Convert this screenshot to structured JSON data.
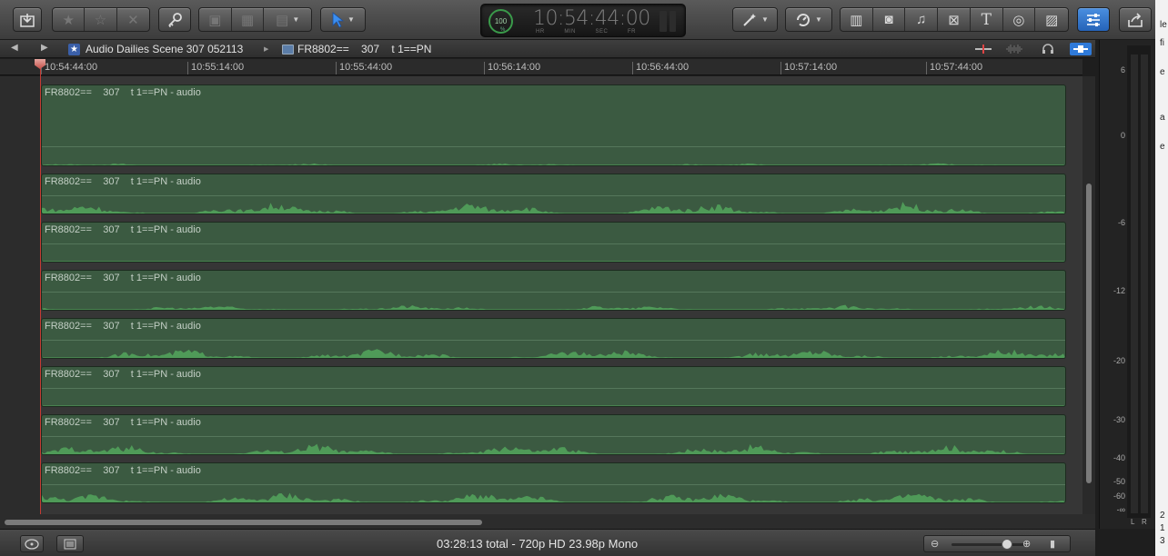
{
  "toolbar": {
    "timecode": "10:54:44:00",
    "timecode_labels": [
      "HR",
      "MIN",
      "SEC",
      "FR"
    ],
    "playback_percent": "100",
    "playback_percent_unit": "%"
  },
  "pathbar": {
    "project": "Audio Dailies Scene 307 052113",
    "clip": "FR8802==    307    t 1==PN"
  },
  "ruler": {
    "ticks": [
      "10:54:44:00",
      "10:55:14:00",
      "10:55:44:00",
      "10:56:14:00",
      "10:56:44:00",
      "10:57:14:00",
      "10:57:44:00"
    ]
  },
  "clips": [
    {
      "label": "FR8802==    307    t 1==PN - audio",
      "waveform_level": 0.1
    },
    {
      "label": "FR8802==    307    t 1==PN - audio",
      "waveform_level": 0.6
    },
    {
      "label": "FR8802==    307    t 1==PN - audio",
      "waveform_level": 0.0
    },
    {
      "label": "FR8802==    307    t 1==PN - audio",
      "waveform_level": 0.25
    },
    {
      "label": "FR8802==    307    t 1==PN - audio",
      "waveform_level": 0.5
    },
    {
      "label": "FR8802==    307    t 1==PN - audio",
      "waveform_level": 0.0
    },
    {
      "label": "FR8802==    307    t 1==PN - audio",
      "waveform_level": 0.55
    },
    {
      "label": "FR8802==    307    t 1==PN - audio",
      "waveform_level": 0.55
    }
  ],
  "status": {
    "summary": "03:28:13 total - 720p HD 23.98p Mono"
  },
  "meters": {
    "scale": [
      "6",
      "0",
      "-6",
      "-12",
      "-20",
      "-30",
      "-40",
      "-50",
      "-60",
      "-∞"
    ],
    "channels": [
      "L",
      "R"
    ]
  },
  "edge_window_fragments": [
    "le",
    "fi",
    "e",
    "a",
    "e",
    "2",
    "1",
    "3"
  ],
  "colors": {
    "clip_fill": "#3b5a41",
    "waveform": "#4f9a58",
    "playhead": "#c43b34",
    "accent_blue": "#2f7ad9"
  }
}
